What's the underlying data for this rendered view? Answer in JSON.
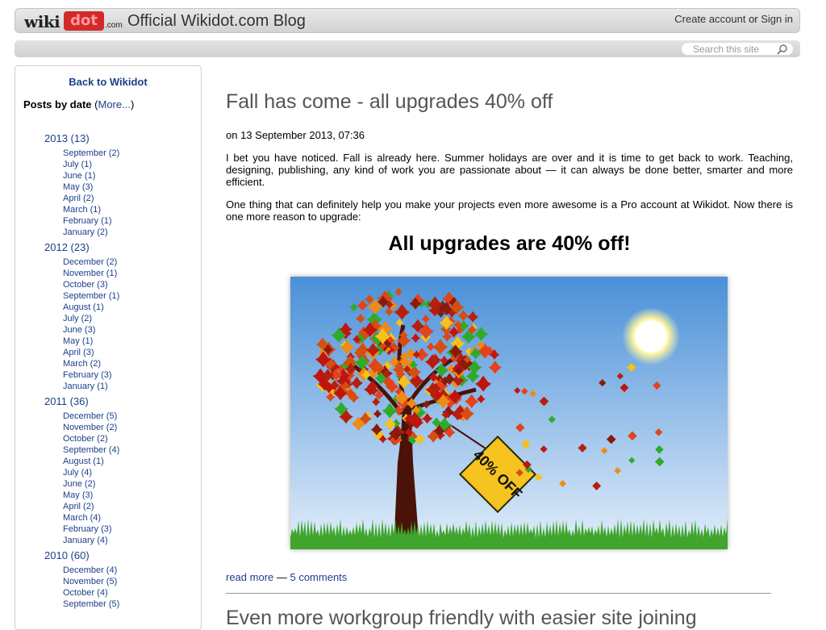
{
  "header": {
    "logo": {
      "wiki": "wiki",
      "dot": "dot",
      "com": ".com"
    },
    "site_title": "Official Wikidot.com Blog",
    "create_account": "Create account",
    "or": "or",
    "sign_in": "Sign in"
  },
  "search": {
    "placeholder": "Search this site",
    "icon": "search-icon"
  },
  "sidebar": {
    "back_link": "Back to Wikidot",
    "posts_by_date": "Posts by date",
    "more_link": "More...",
    "archive": [
      {
        "year": "2013 (13)",
        "months": [
          "September (2)",
          "July (1)",
          "June (1)",
          "May (3)",
          "April (2)",
          "March (1)",
          "February (1)",
          "January (2)"
        ]
      },
      {
        "year": "2012 (23)",
        "months": [
          "December (2)",
          "November (1)",
          "October (3)",
          "September (1)",
          "August (1)",
          "July (2)",
          "June (3)",
          "May (1)",
          "April (3)",
          "March (2)",
          "February (3)",
          "January (1)"
        ]
      },
      {
        "year": "2011 (36)",
        "months": [
          "December (5)",
          "November (2)",
          "October (2)",
          "September (4)",
          "August (1)",
          "July (4)",
          "June (2)",
          "May (3)",
          "April (2)",
          "March (4)",
          "February (3)",
          "January (4)"
        ]
      },
      {
        "year": "2010 (60)",
        "months": [
          "December (4)",
          "November (5)",
          "October (4)",
          "September (5)"
        ]
      }
    ]
  },
  "post": {
    "title": "Fall has come - all upgrades 40% off",
    "date": "on 13 September 2013, 07:36",
    "paragraph1": "I bet you have noticed. Fall is already here. Summer holidays are over and it is time to get back to work. Teaching, designing, publishing, any kind of work you are passionate about — it can always be done better, smarter and more efficient.",
    "paragraph2": "One thing that can definitely help you make your projects even more awesome is a Pro account at Wikidot. Now there is one more reason to upgrade:",
    "headline": "All upgrades are 40% off!",
    "image_sign_text": "40% OFF",
    "read_more": "read more",
    "separator": " — ",
    "comments": "5 comments"
  },
  "next_post": {
    "title": "Even more workgroup friendly with easier site joining"
  },
  "colors": {
    "accent_link": "#1c3f8a",
    "logo_red": "#d22a2a",
    "sky_top": "#4a90d8",
    "grass": "#3fa52c"
  }
}
